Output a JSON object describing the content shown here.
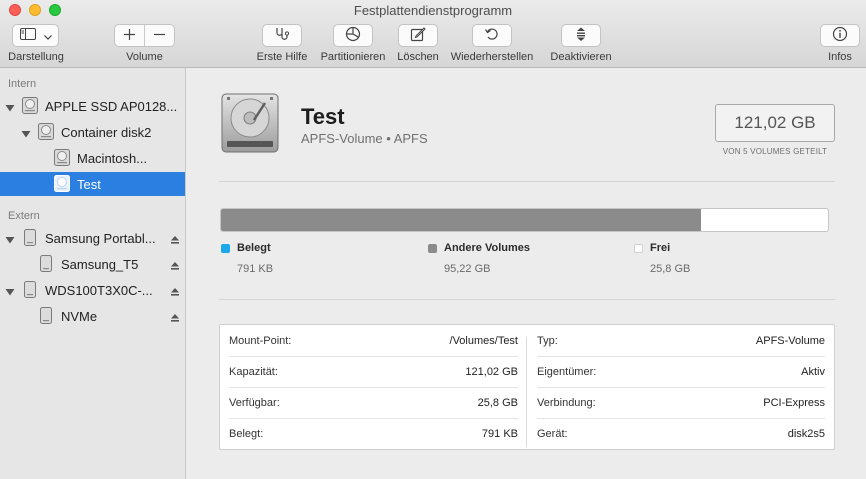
{
  "window": {
    "title": "Festplattendienstprogramm"
  },
  "toolbar": {
    "darstellung_label": "Darstellung",
    "volume_label": "Volume",
    "erste_hilfe_label": "Erste Hilfe",
    "partitionieren_label": "Partitionieren",
    "loeschen_label": "Löschen",
    "wiederherstellen_label": "Wiederherstellen",
    "deaktivieren_label": "Deaktivieren",
    "infos_label": "Infos"
  },
  "sidebar": {
    "intern_header": "Intern",
    "extern_header": "Extern",
    "items": [
      {
        "label": "APPLE SSD AP0128..."
      },
      {
        "label": "Container disk2"
      },
      {
        "label": "Macintosh..."
      },
      {
        "label": "Test"
      },
      {
        "label": "Samsung Portabl..."
      },
      {
        "label": "Samsung_T5"
      },
      {
        "label": "WDS100T3X0C-..."
      },
      {
        "label": "NVMe"
      }
    ]
  },
  "volume": {
    "name": "Test",
    "subtitle": "APFS-Volume • APFS",
    "size": "121,02 GB",
    "size_note": "VON 5 VOLUMES GETEILT"
  },
  "usage": {
    "used_fraction": 0.0,
    "other_fraction": 0.79,
    "colors": {
      "used": "#1aa7ec",
      "other": "#8b8b8b",
      "free": "#ffffff"
    },
    "legend": [
      {
        "label": "Belegt",
        "value": "791 KB"
      },
      {
        "label": "Andere Volumes",
        "value": "95,22 GB"
      },
      {
        "label": "Frei",
        "value": "25,8 GB"
      }
    ]
  },
  "details": {
    "left": [
      {
        "key": "Mount-Point:",
        "value": "/Volumes/Test"
      },
      {
        "key": "Kapazität:",
        "value": "121,02 GB"
      },
      {
        "key": "Verfügbar:",
        "value": "25,8 GB"
      },
      {
        "key": "Belegt:",
        "value": "791 KB"
      }
    ],
    "right": [
      {
        "key": "Typ:",
        "value": "APFS-Volume"
      },
      {
        "key": "Eigentümer:",
        "value": "Aktiv"
      },
      {
        "key": "Verbindung:",
        "value": "PCI-Express"
      },
      {
        "key": "Gerät:",
        "value": "disk2s5"
      }
    ]
  }
}
